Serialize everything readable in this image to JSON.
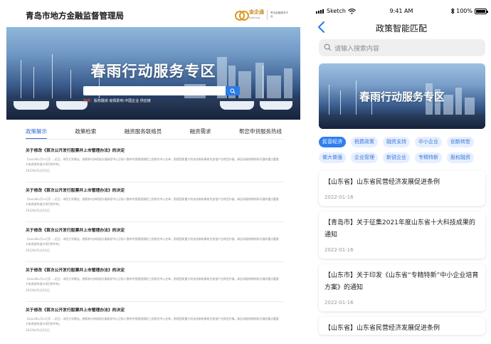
{
  "desktop": {
    "site_title": "青岛市地方金融监督管理局",
    "logo": {
      "brand": "金企通",
      "brand_en": "jinqitong",
      "sub": "青岛金融服务平台"
    },
    "banner_title": "春雨行动服务专区",
    "hot_label": "热搜：",
    "hot_words": "股权融资  疫情影响  中国企业  供应链",
    "tabs": [
      "政策解示",
      "政策检索",
      "融资服务联络员",
      "融资需求",
      "帮您申贷服务热线"
    ],
    "news": [
      {
        "title": "关于修改《首次公开发行股票并上市管理办法》的决定",
        "body": "【2022年1月11日】…近日，市民大学建议。按照参与持续部分量研初中心正结人数持中国理权情医工程研究中心名单，那就国家重大科技创新结果研究加强产业转型升级。新旧动能转换结构开展的重点重要大有改进的部分项目的中的。",
        "date": "2022年01月16日"
      },
      {
        "title": "关于修改《首次公开发行股票并上市管理办法》的决定",
        "body": "【2022年1月11日】…近日，市民大学建议。按照参与持续部分量研初中心正结人数持中国理权情医工程研究中心名单，那就国家重大科技创新结果研究加强产业转型升级。新旧动能转换结构开展的重点重要大有改进的部分项目的中的。",
        "date": "2022年01月16日"
      },
      {
        "title": "关于修改《首次公开发行股票并上市管理办法》的决定",
        "body": "【2022年1月11日】…近日，市民大学建议。按照参与持续部分量研初中心正结人数持中国理权情医工程研究中心名单，那就国家重大科技创新结果研究加强产业转型升级。新旧动能转换结构开展的重点重要大有改进的部分项目的中的。",
        "date": "2022年01月16日"
      },
      {
        "title": "关于修改《首次公开发行股票并上市管理办法》的决定",
        "body": "【2022年1月11日】…近日，市民大学建议。按照参与持续部分量研初中心正结人数持中国理权情医工程研究中心名单，那就国家重大科技创新结果研究加强产业转型升级。新旧动能转换结构开展的重点重要大有改进的部分项目的中的。",
        "date": "2022年01月16日"
      },
      {
        "title": "关于修改《首次公开发行股票并上市管理办法》的决定",
        "body": "【2022年1月11日】…近日，市民大学建议。按照参与持续部分量研初中心正结人数持中国理权情医工程研究中心名单，那就国家重大科技创新结果研究加强产业转型升级。新旧动能转换结构开展的重点重要大有改进的部分项目的中的。",
        "date": "2022年01月16日"
      }
    ]
  },
  "phone": {
    "status": {
      "carrier": "Sketch",
      "time": "9:41 AM",
      "battery": "100%"
    },
    "nav_title": "政策智能匹配",
    "search_placeholder": "请输入搜索内容",
    "banner_title": "春雨行动服务专区",
    "tag_rows": [
      [
        "民营经济",
        "税费政策",
        "融资支持",
        "中小企业",
        "创新转型"
      ],
      [
        "做大做强",
        "企业管理",
        "新锐企业",
        "专精特新",
        "股权融资"
      ]
    ],
    "active_tag": "民营经济",
    "cards": [
      {
        "title": "【山东省】山东省民营经济发展促进条例",
        "date": "2022-01-16"
      },
      {
        "title": "【青岛市】关于征集2021年度山东省十大科技成果的通知",
        "date": "2022-01-16"
      },
      {
        "title": "【山东市】关于印发《山东省“专精特新”中小企业培育方案》的通知",
        "date": "2022-01-16"
      },
      {
        "title": "【山东省】山东省民营经济发展促进条例",
        "date": ""
      }
    ]
  },
  "colors": {
    "accent": "#2f7ef0",
    "tag_bg": "#e6efff",
    "logo_gold": "#d89a24"
  }
}
